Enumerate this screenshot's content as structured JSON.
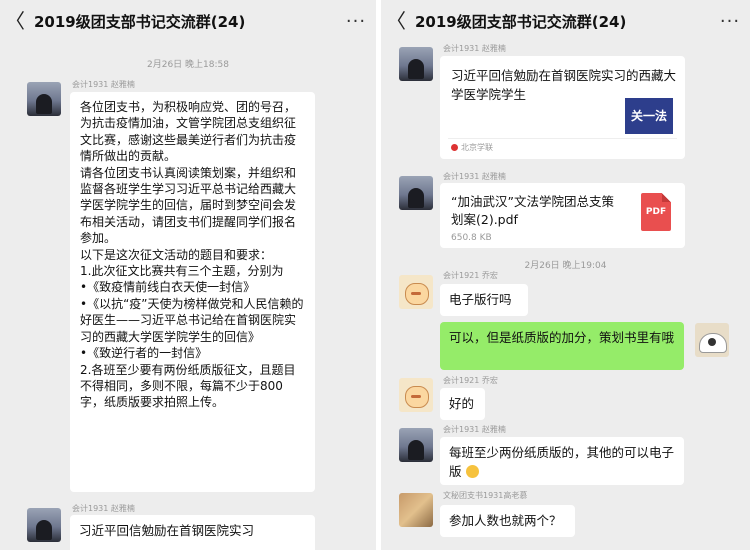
{
  "group_title": "2019级团支部书记交流群(24)",
  "back_glyph": "〈",
  "more_glyph": "···",
  "left_screen": {
    "time_divider": "2月26日 晚上18:58",
    "sender_1": "会计1931 赵雅楠",
    "long_message": "各位团支书，为积极响应党、团的号召，为抗击疫情加油，文管学院团总支组织征文比赛，感谢这些最美逆行者们为抗击疫情所做出的贡献。\n请各位团支书认真阅读策划案，并组织和监督各班学生学习习近平总书记给西藏大学医学院学生的回信，届时到梦空间会发布相关活动，请团支书们提醒同学们报名参加。\n以下是这次征文活动的题目和要求：\n1.此次征文比赛共有三个主题，分别为\n•《致疫情前线白衣天使一封信》\n•《以抗“疫”天使为榜样做党和人民信赖的好医生——习近平总书记给在首钢医院实习的西藏大学医学院学生的回信》\n•《致逆行者的一封信》\n2.各班至少要有两份纸质版征文，且题目不得相同，多则不限，每篇不少于800字，纸质版要求拍照上传。",
    "sender_2": "会计1931 赵雅楠",
    "partial_message": "习近平回信勉励在首钢医院实习"
  },
  "right_screen": {
    "sender_1": "会计1931 赵雅楠",
    "article_title": "习近平回信勉励在首钢医院实习的西藏大学医学院学生",
    "article_thumb": "关一法",
    "article_source": "北京学联",
    "sender_2": "会计1931 赵雅楠",
    "file_name": "“加油武汉”文法学院团总支策划案(2).pdf",
    "file_size": "650.8 KB",
    "pdf_label": "PDF",
    "time_divider": "2月26日 晚上19:04",
    "sender_3": "会计1921 乔宏",
    "msg_1": "电子版行吗",
    "msg_self": "可以，但是纸质版的加分，策划书里有哦",
    "sender_4": "会计1921 乔宏",
    "msg_2": "好的",
    "sender_5": "会计1931 赵雅楠",
    "msg_3": "每班至少两份纸质版的，其他的可以电子版",
    "sender_6": "文秘团支书1931高老慕",
    "msg_4": "参加人数也就两个？"
  }
}
